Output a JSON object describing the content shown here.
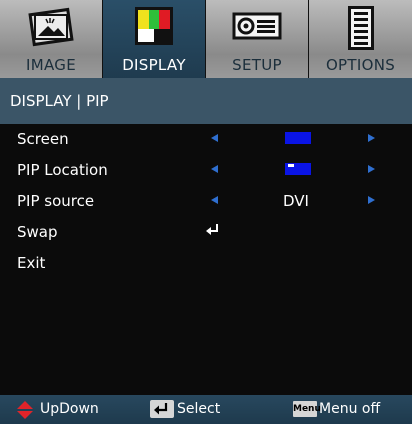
{
  "tabs": [
    {
      "label": "IMAGE",
      "icon": "image-icon",
      "active": false
    },
    {
      "label": "DISPLAY",
      "icon": "display-icon",
      "active": true
    },
    {
      "label": "SETUP",
      "icon": "setup-projector-icon",
      "active": false
    },
    {
      "label": "OPTIONS",
      "icon": "options-icon",
      "active": false
    }
  ],
  "title": "DISPLAY | PIP",
  "menu": {
    "items": [
      {
        "label": "Screen"
      },
      {
        "label": "PIP Location"
      },
      {
        "label": "PIP source",
        "value": "DVI"
      },
      {
        "label": "Swap"
      },
      {
        "label": "Exit"
      }
    ]
  },
  "help": {
    "updown": "UpDown",
    "select": "Select",
    "menu_key": "Menu",
    "menu_off": "Menu off"
  },
  "colors": {
    "active_tab": "#1f3b4f",
    "title_bar": "#3b5567",
    "arrow": "#2f6fd0",
    "value_box": "#0a14e6"
  }
}
